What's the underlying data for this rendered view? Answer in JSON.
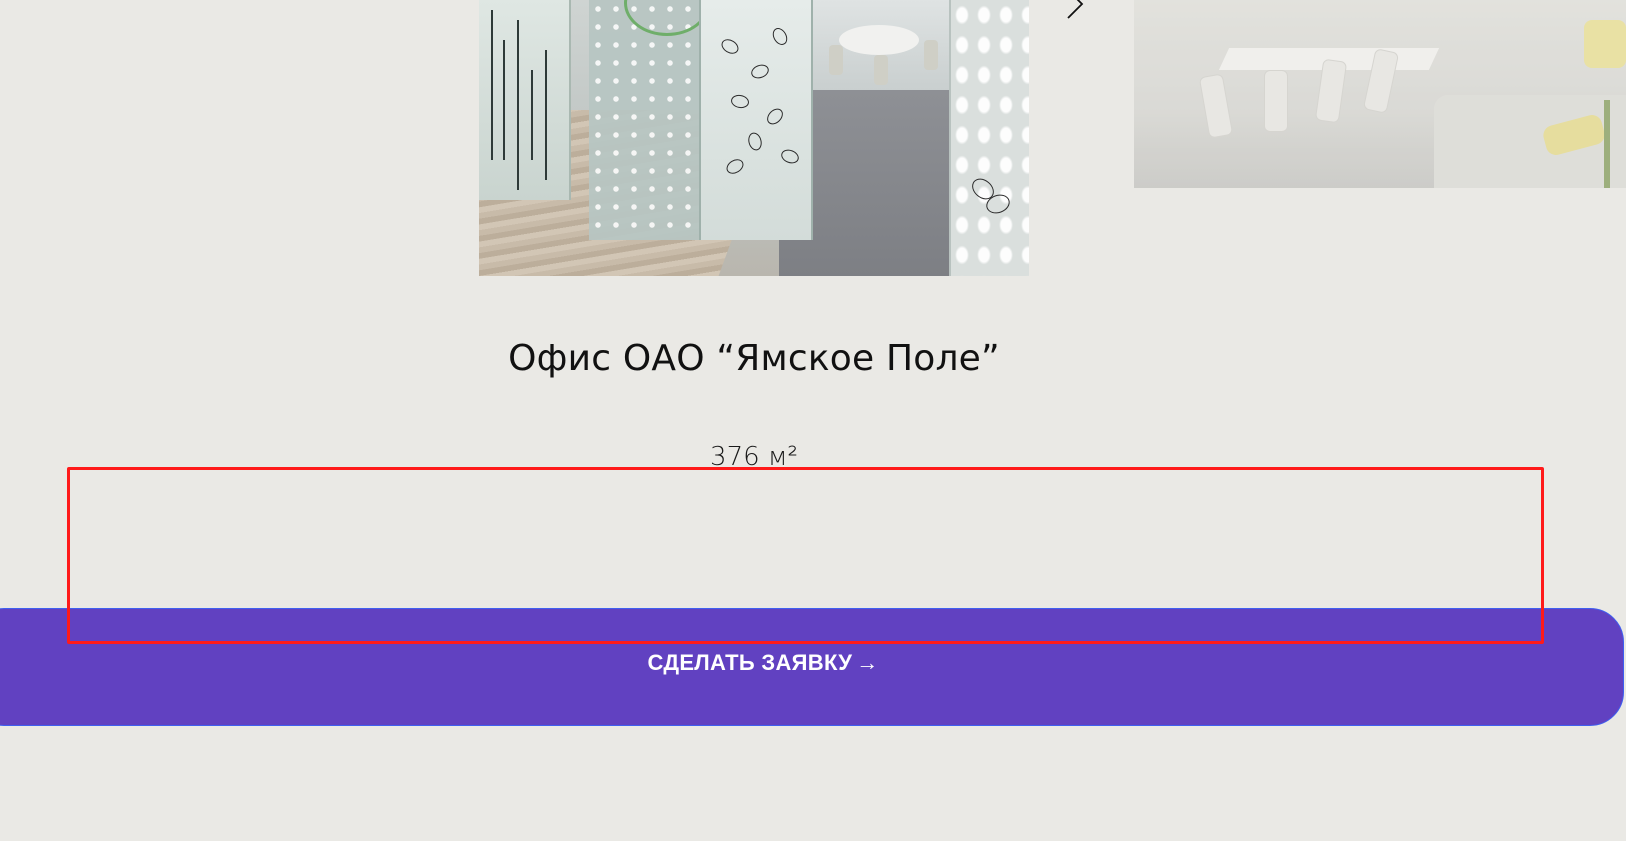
{
  "project": {
    "title": "Офис ОАО “Ямское Поле”",
    "area": "376 м²"
  },
  "gallery": {
    "main_image": "office-entrance-photo",
    "secondary_image": "office-lounge-photo",
    "next_icon": "chevron-right-icon"
  },
  "cta": {
    "label": "СДЕЛАТЬ ЗАЯВКУ",
    "arrow": "→",
    "background_color": "#6141c1",
    "border_color": "#3f5ff0"
  },
  "overlay": {
    "selection_color": "#ff1a1a"
  },
  "page": {
    "background_color": "#eae9e5"
  }
}
